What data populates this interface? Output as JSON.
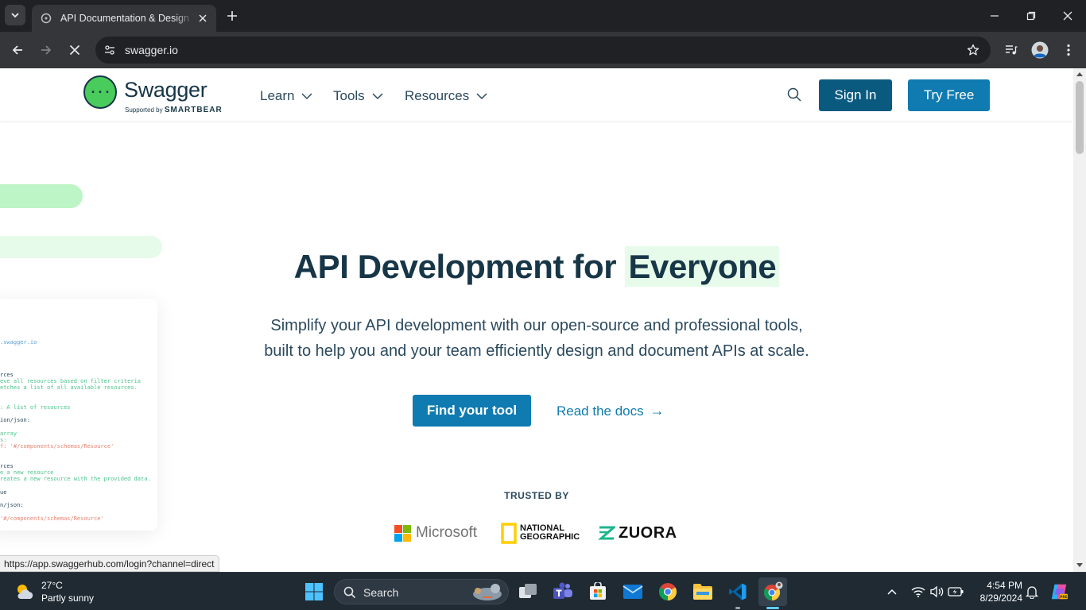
{
  "browser": {
    "tab_title": "API Documentation & Design Tools for Teams | Swagger",
    "url": "swagger.io",
    "status_url": "https://app.swaggerhub.com/login?channel=direct"
  },
  "header": {
    "logo_word": "Swagger",
    "logo_tm": "™",
    "logo_supported": "Supported by",
    "logo_company": "SMARTBEAR",
    "nav": [
      {
        "label": "Learn"
      },
      {
        "label": "Tools"
      },
      {
        "label": "Resources"
      }
    ],
    "signin_label": "Sign In",
    "tryfree_label": "Try Free"
  },
  "hero": {
    "title_prefix": "API Development for",
    "title_highlight": "Everyone",
    "subtitle_line1": "Simplify your API development with our open-source and professional tools,",
    "subtitle_line2": "built to help you and your team efficiently design and document APIs at scale.",
    "primary_cta": "Find your tool",
    "secondary_cta": "Read the docs",
    "secondary_arrow": "→"
  },
  "code_card": {
    "lines": [
      {
        "text": ".swagger.io",
        "color": "#5aa0d8"
      },
      {
        "text": "rces",
        "color": "#2b4a5e"
      },
      {
        "text": "eve all resources based on filter criteria",
        "color": "#4ac48a"
      },
      {
        "text": "etches a list of all available resources.",
        "color": "#4ac48a"
      },
      {
        "text": ": A list of resources",
        "color": "#4ac48a"
      },
      {
        "text": "ion/json:",
        "color": "#2b4a5e"
      },
      {
        "text": " array",
        "color": "#4ac48a"
      },
      {
        "text": "s:",
        "color": "#4ac48a"
      },
      {
        "text": "f: '#/components/schemas/Resource'",
        "color": "#e8836f"
      },
      {
        "text": "rces",
        "color": "#2b4a5e"
      },
      {
        "text": "e a new resource",
        "color": "#4ac48a"
      },
      {
        "text": "reates a new resource with the provided data.",
        "color": "#4ac48a"
      },
      {
        "text": "ue",
        "color": "#2b4a5e"
      },
      {
        "text": "n/json:",
        "color": "#2b4a5e"
      },
      {
        "text": "'#/components/schemas/Resource'",
        "color": "#e8836f"
      }
    ]
  },
  "trusted": {
    "label": "TRUSTED BY",
    "brands": [
      "Microsoft",
      "NATIONAL GEOGRAPHIC",
      "ZUORA"
    ]
  },
  "taskbar": {
    "temperature": "27°C",
    "weather_desc": "Partly sunny",
    "search_label": "Search",
    "time": "4:54 PM",
    "date": "8/29/2024"
  },
  "colors": {
    "swagger_green": "#49cc5c",
    "navy": "#173647",
    "signin_bg": "#0a5a80",
    "primary_bg": "#0f7bb0",
    "highlight_bg": "#e6fbe9"
  }
}
